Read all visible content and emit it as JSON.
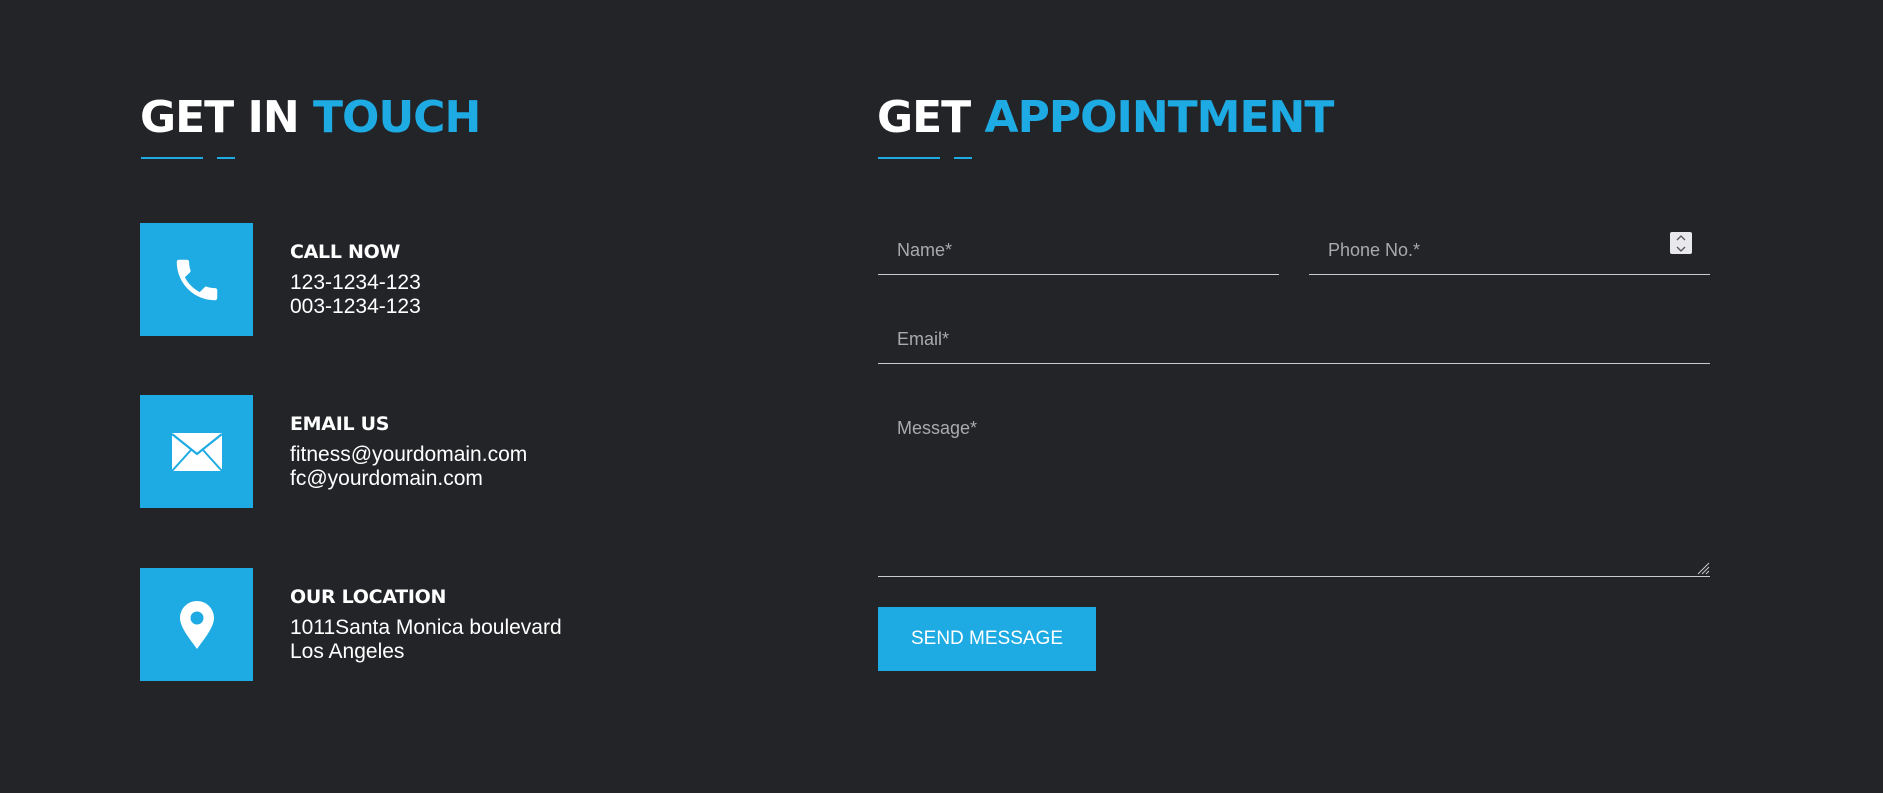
{
  "colors": {
    "background": "#232428",
    "accent": "#1eaae2",
    "text": "#ffffff",
    "placeholder": "#a9aaad",
    "field_line": "#c9cacc"
  },
  "contact_section": {
    "title_part1": "GET IN",
    "title_part2": "TOUCH",
    "items": [
      {
        "icon": "phone-icon",
        "heading": "CALL NOW",
        "line1": "123-1234-123",
        "line2": "003-1234-123"
      },
      {
        "icon": "envelope-icon",
        "heading": "EMAIL US",
        "line1": "fitness@yourdomain.com",
        "line2": "fc@yourdomain.com"
      },
      {
        "icon": "map-pin-icon",
        "heading": "OUR LOCATION",
        "line1": "1011Santa Monica boulevard",
        "line2": "Los Angeles"
      }
    ]
  },
  "appointment_section": {
    "title_part1": "GET",
    "title_part2": "APPOINTMENT",
    "form": {
      "name_placeholder": "Name*",
      "phone_placeholder": "Phone No.*",
      "email_placeholder": "Email*",
      "message_placeholder": "Message*",
      "submit_label": "SEND MESSAGE"
    }
  }
}
